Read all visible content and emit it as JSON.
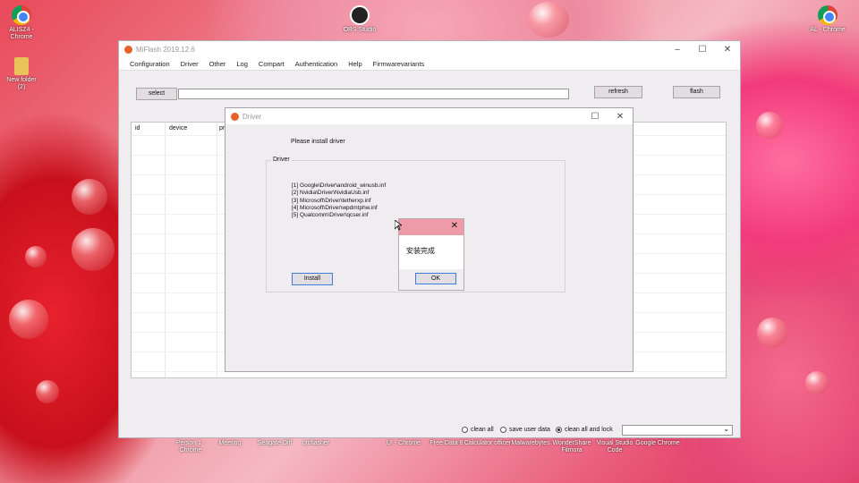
{
  "desktop": {
    "icons": [
      {
        "label": "ALISZ4 -\nChrome",
        "icon": "chrome-icon"
      },
      {
        "label": "New folder\n(2)",
        "icon": "folder-icon"
      },
      {
        "label": "OBS Studio",
        "icon": "obs-icon"
      },
      {
        "label": "AL - Chrome",
        "icon": "chrome-icon"
      }
    ],
    "taskbar_icons": [
      "Person 1 -\nChrome",
      "Meeting",
      "Seagate Diff",
      "otcflasher",
      "UI - Chrome",
      "Free Data 8",
      "Calculator\nofficer",
      "Malwarebytes",
      "WonderShare\nFilmora",
      "Visual Studio\nCode",
      "Google\nChrome"
    ]
  },
  "main_window": {
    "title": "MiFlash 2019.12.6",
    "menu": [
      "Configuration",
      "Driver",
      "Other",
      "Log",
      "Compart",
      "Authentication",
      "Help",
      "Firmwarevariants"
    ],
    "select_label": "select",
    "path_value": "",
    "refresh_label": "refresh",
    "flash_label": "flash",
    "table_headers": [
      "id",
      "device",
      "pr"
    ],
    "radio_clean_all": "clean all",
    "radio_save_user_data": "save user data",
    "radio_clean_all_lock": "clean all and lock",
    "selected_option": "clean all and lock",
    "dropdown_value": ""
  },
  "driver_dialog": {
    "title": "Driver",
    "message": "Please install driver",
    "group_label": "Driver",
    "drivers": [
      "[1] Google\\Driver\\android_winusb.inf",
      "[2] Nvidia\\Driver\\NvidiaUsb.inf",
      "[3] Microsoft\\Driver\\tetherxp.inf",
      "[4] Microsoft\\Driver\\wpdmtphw.inf",
      "[5] Qualcomm\\Driver\\qcser.inf"
    ],
    "install_label": "Install"
  },
  "message_box": {
    "text": "安装完成",
    "ok_label": "OK"
  }
}
